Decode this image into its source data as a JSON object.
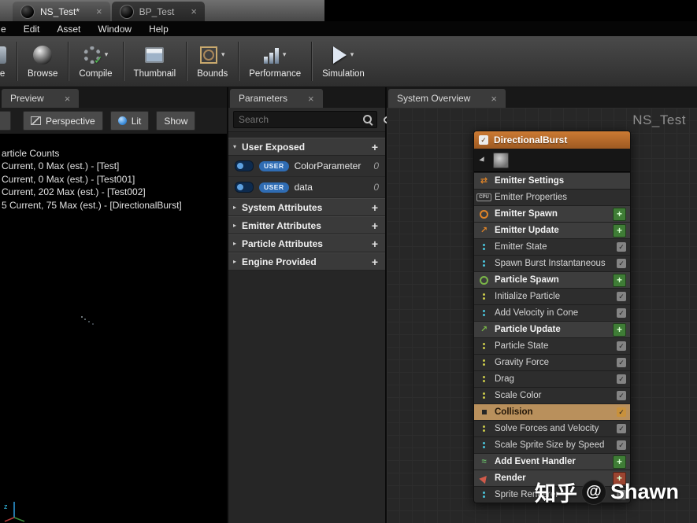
{
  "window": {
    "tabs": [
      {
        "label": "NS_Test*",
        "active": true
      },
      {
        "label": "BP_Test",
        "active": false
      }
    ],
    "menu_items": [
      "e",
      "Edit",
      "Asset",
      "Window",
      "Help"
    ]
  },
  "toolbar": {
    "buttons": [
      {
        "label": "ave",
        "icon": "save-icon",
        "dropdown": false,
        "cropped": true
      },
      {
        "label": "Browse",
        "icon": "browse-icon",
        "dropdown": false
      },
      {
        "label": "Compile",
        "icon": "compile-icon",
        "dropdown": true
      },
      {
        "label": "Thumbnail",
        "icon": "thumbnail-icon",
        "dropdown": false
      },
      {
        "label": "Bounds",
        "icon": "bounds-icon",
        "dropdown": true
      },
      {
        "label": "Performance",
        "icon": "performance-icon",
        "dropdown": true
      },
      {
        "label": "Simulation",
        "icon": "simulation-icon",
        "dropdown": true
      }
    ]
  },
  "preview": {
    "tab_label": "Preview",
    "buttons": [
      {
        "label": "Perspective",
        "icon": "perspective-icon"
      },
      {
        "label": "Lit",
        "icon": "lit-icon"
      },
      {
        "label": "Show",
        "icon": ""
      }
    ],
    "stats": [
      "article Counts",
      "Current, 0 Max (est.) - [Test]",
      "Current, 0 Max (est.) - [Test001]",
      "Current, 202 Max (est.) - [Test002]",
      "5 Current, 75 Max (est.) - [DirectionalBurst]"
    ]
  },
  "parameters": {
    "tab_label": "Parameters",
    "search_placeholder": "Search",
    "sections": [
      {
        "label": "User Exposed",
        "expanded": true,
        "rows": [
          {
            "badge": "USER",
            "name": "ColorParameter",
            "value": "0"
          },
          {
            "badge": "USER",
            "name": "data",
            "value": "0"
          }
        ]
      },
      {
        "label": "System Attributes",
        "expanded": false,
        "rows": []
      },
      {
        "label": "Emitter Attributes",
        "expanded": false,
        "rows": []
      },
      {
        "label": "Particle Attributes",
        "expanded": false,
        "rows": []
      },
      {
        "label": "Engine Provided",
        "expanded": false,
        "rows": []
      }
    ]
  },
  "overview": {
    "tab_label": "System Overview",
    "canvas_label": "NS_Test",
    "node": {
      "title": "DirectionalBurst",
      "enabled": true,
      "rows": [
        {
          "label": "Emitter Settings",
          "kind": "header",
          "icon": "emitter-settings-icon",
          "icon_color": "#e08428"
        },
        {
          "label": "Emitter Properties",
          "kind": "item",
          "icon": "cpu-icon",
          "icon_color": "#9a9a9a",
          "check": false
        },
        {
          "label": "Emitter Spawn",
          "kind": "header",
          "icon": "emitter-spawn-icon",
          "icon_color": "#e08428",
          "plus_color": "#3f7d36"
        },
        {
          "label": "Emitter Update",
          "kind": "header",
          "icon": "emitter-update-icon",
          "icon_color": "#e08428",
          "plus_color": "#3f7d36"
        },
        {
          "label": "Emitter State",
          "kind": "item",
          "icon": "module-icon",
          "icon_color": "#49c2d8",
          "check": true
        },
        {
          "label": "Spawn Burst Instantaneous",
          "kind": "item",
          "icon": "module-icon",
          "icon_color": "#49c2d8",
          "check": true
        },
        {
          "label": "Particle Spawn",
          "kind": "header",
          "icon": "particle-spawn-icon",
          "icon_color": "#7ab648",
          "plus_color": "#3f7d36"
        },
        {
          "label": "Initialize Particle",
          "kind": "item",
          "icon": "module-icon",
          "icon_color": "#c9c94a",
          "check": true
        },
        {
          "label": "Add Velocity in Cone",
          "kind": "item",
          "icon": "module-icon",
          "icon_color": "#49c2d8",
          "check": true
        },
        {
          "label": "Particle Update",
          "kind": "header",
          "icon": "particle-update-icon",
          "icon_color": "#7ab648",
          "plus_color": "#3f7d36"
        },
        {
          "label": "Particle State",
          "kind": "item",
          "icon": "module-icon",
          "icon_color": "#c9c94a",
          "check": true
        },
        {
          "label": "Gravity Force",
          "kind": "item",
          "icon": "module-icon",
          "icon_color": "#c9c94a",
          "check": true
        },
        {
          "label": "Drag",
          "kind": "item",
          "icon": "module-icon",
          "icon_color": "#c9c94a",
          "check": true
        },
        {
          "label": "Scale Color",
          "kind": "item",
          "icon": "module-icon",
          "icon_color": "#c9c94a",
          "check": true
        },
        {
          "label": "Collision",
          "kind": "item",
          "icon": "collision-icon",
          "icon_color": "#262626",
          "check": true,
          "selected": true
        },
        {
          "label": "Solve Forces and Velocity",
          "kind": "item",
          "icon": "module-icon",
          "icon_color": "#c9c94a",
          "check": true
        },
        {
          "label": "Scale Sprite Size by Speed",
          "kind": "item",
          "icon": "module-icon",
          "icon_color": "#49c2d8",
          "check": true
        },
        {
          "label": "Add Event Handler",
          "kind": "header",
          "icon": "event-handler-icon",
          "icon_color": "#67b868",
          "plus_color": "#3f7d36"
        },
        {
          "label": "Render",
          "kind": "header",
          "icon": "render-icon",
          "icon_color": "#d05a4a",
          "plus_color": "#9c4531"
        },
        {
          "label": "Sprite Renderer",
          "kind": "item",
          "icon": "module-icon",
          "icon_color": "#49c2d8",
          "check": true
        }
      ]
    }
  },
  "watermark": {
    "text_left": "知乎",
    "at": "@",
    "text_right": "Shawn"
  },
  "colors": {
    "emitter_header": "#c1712e",
    "selected_row": "#b9905c",
    "plus_green": "#3f7d36",
    "plus_red": "#9c4531",
    "user_badge_blue": "#2f6cb3",
    "canvas_grid": "#272727"
  }
}
